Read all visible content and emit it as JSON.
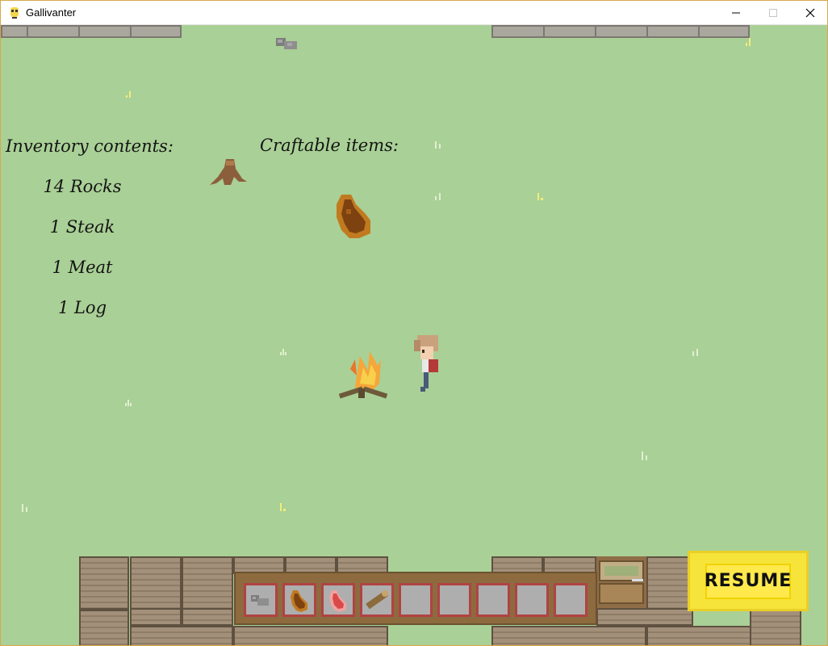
{
  "window": {
    "title": "Gallivanter"
  },
  "hud": {
    "inventory_heading": "Inventory contents:",
    "craftable_heading": "Craftable items:",
    "inventory_items": [
      "14 Rocks",
      "1 Steak",
      "1 Meat",
      "1 Log"
    ],
    "resume_label": "RESUME"
  },
  "hotbar": {
    "slots": [
      {
        "item": "rocks"
      },
      {
        "item": "steak"
      },
      {
        "item": "meat"
      },
      {
        "item": "log"
      },
      {
        "item": "empty"
      },
      {
        "item": "empty"
      },
      {
        "item": "empty"
      },
      {
        "item": "empty"
      },
      {
        "item": "empty"
      }
    ]
  },
  "colors": {
    "grass": "#a9d096",
    "resume_button": "#f6e43a",
    "slot_border": "#b04343",
    "hotbar": "#8d6b3f"
  }
}
